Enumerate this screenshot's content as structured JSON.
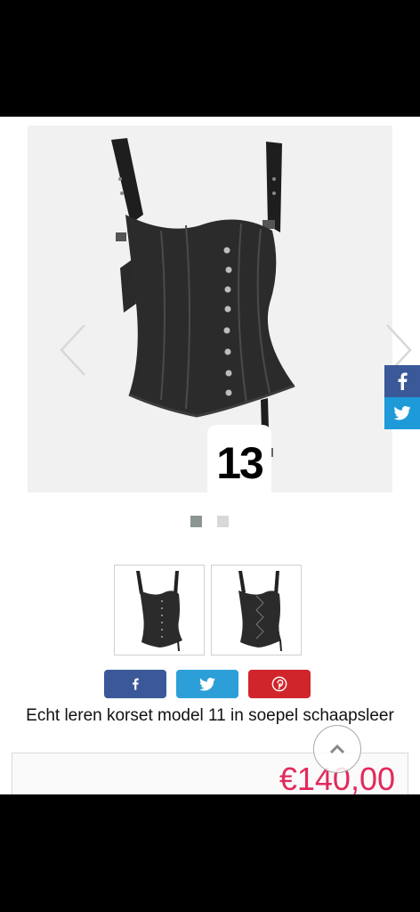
{
  "gallery": {
    "image_name": "corset-main-image",
    "counter": "13",
    "prev_icon": "chevron-left-icon",
    "next_icon": "chevron-right-icon",
    "dots": [
      {
        "state": "active"
      },
      {
        "state": "inactive"
      }
    ]
  },
  "side_share": {
    "facebook_icon": "facebook-icon",
    "twitter_icon": "twitter-icon"
  },
  "thumbnails": [
    {
      "name": "front-view"
    },
    {
      "name": "back-view"
    }
  ],
  "share": {
    "buttons": [
      {
        "icon": "facebook-icon",
        "color": "#3b5998"
      },
      {
        "icon": "twitter-icon",
        "color": "#2d9fd8"
      },
      {
        "icon": "pinterest-icon",
        "color": "#d0252b"
      }
    ]
  },
  "product": {
    "title": "Echt leren korset model 11 in soepel schaapsleer",
    "price": "€140,00"
  },
  "colors": {
    "price": "#e22a5c",
    "facebook": "#3b5998",
    "twitter": "#1e9ad8",
    "pinterest": "#d0252b"
  }
}
